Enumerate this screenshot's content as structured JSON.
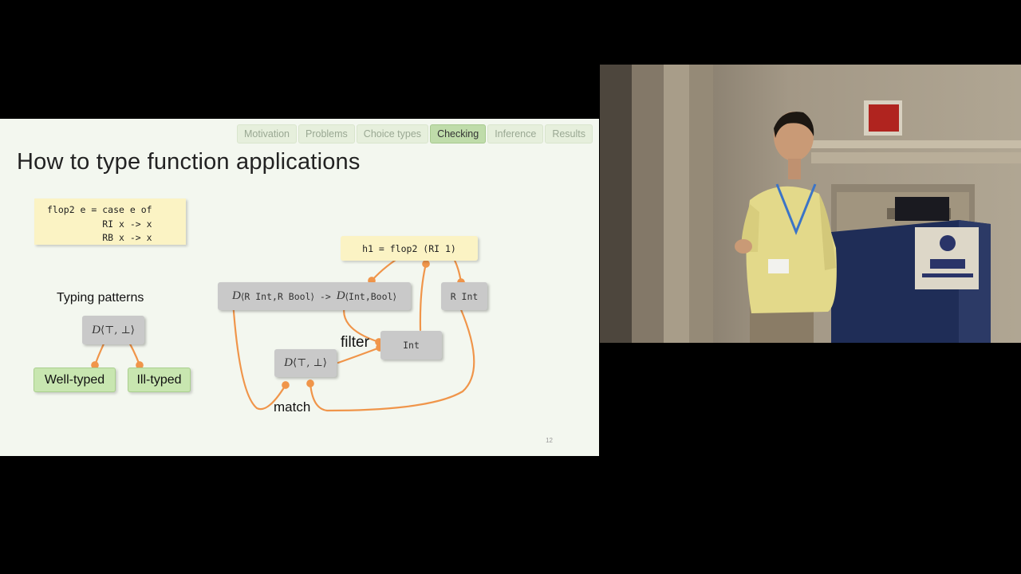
{
  "nav": {
    "tabs": [
      {
        "label": "Motivation",
        "active": false
      },
      {
        "label": "Problems",
        "active": false
      },
      {
        "label": "Choice types",
        "active": false
      },
      {
        "label": "Checking",
        "active": true
      },
      {
        "label": "Inference",
        "active": false
      },
      {
        "label": "Results",
        "active": false
      }
    ]
  },
  "slide": {
    "title": "How to type function applications",
    "code": {
      "line1": "flop2 e = case e of",
      "line2": "          RI x -> x",
      "line3": "          RB x -> x"
    },
    "typing_patterns": {
      "heading": "Typing patterns",
      "root": {
        "d": "D",
        "args": "⟨⊤, ⊥⟩"
      },
      "well_typed": "Well-typed",
      "ill_typed": "Ill-typed"
    },
    "graph": {
      "h1": "h1 = flop2 (RI 1)",
      "fn_type": {
        "d1": "D",
        "l1": "⟨",
        "a1": "R Int",
        "c1": ",",
        "a2": "R Bool",
        "r1": "⟩",
        "arrow": " -> ",
        "d2": "D",
        "l2": "⟨",
        "a3": "Int",
        "c2": ",",
        "a4": "Bool",
        "r2": "⟩"
      },
      "r_int": "R Int",
      "int": "Int",
      "pattern": {
        "d": "D",
        "args": "⟨⊤, ⊥⟩"
      },
      "filter_label": "filter",
      "match_label": "match"
    },
    "page_number": "12"
  },
  "colors": {
    "arrow": "#f0954a",
    "active_tab": "#bfdcaa",
    "node_gray": "#c9c9c9",
    "code_bg": "#fbf3c4",
    "result_green": "#c8e6b0"
  }
}
